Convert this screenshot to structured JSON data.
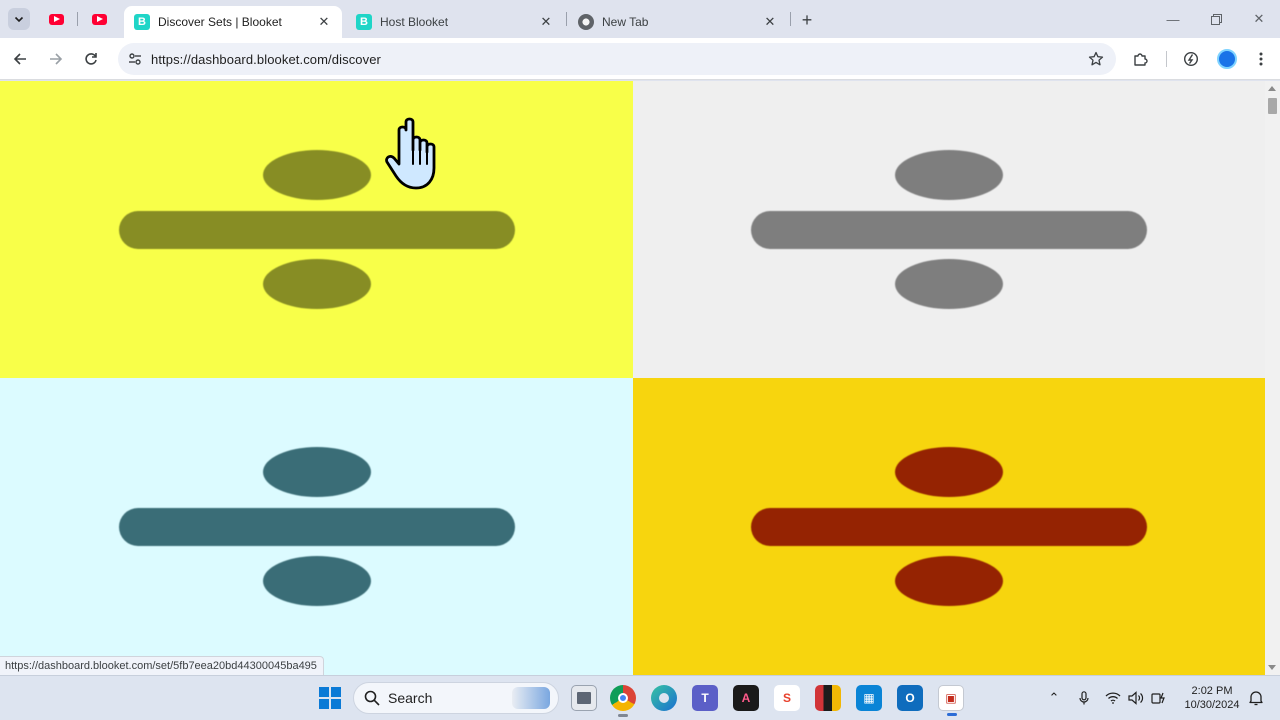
{
  "browser": {
    "tabs": [
      {
        "title": "Discover Sets | Blooket",
        "active": true
      },
      {
        "title": "Host Blooket",
        "active": false
      },
      {
        "title": "New Tab",
        "active": false
      }
    ],
    "url": "https://dashboard.blooket.com/discover",
    "status_url": "https://dashboard.blooket.com/set/5fb7eea20bd44300045ba495"
  },
  "page": {
    "tiles": [
      {
        "background": "#f8ff49",
        "symbol_color": "#878d24"
      },
      {
        "background": "#efefef",
        "symbol_color": "#7e7e7e"
      },
      {
        "background": "#dcfbff",
        "symbol_color": "#3a6d77"
      },
      {
        "background": "#f7d50e",
        "symbol_color": "#952302"
      }
    ]
  },
  "taskbar": {
    "search_label": "Search",
    "time": "2:02 PM",
    "date": "10/30/2024"
  }
}
